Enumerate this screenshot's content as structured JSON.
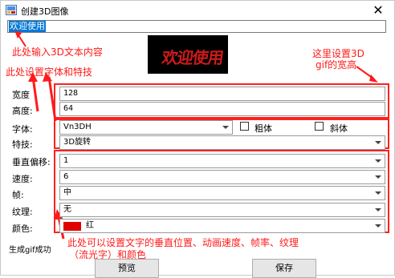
{
  "window": {
    "title": "创建3D图像",
    "close_glyph": "✕"
  },
  "text_input": {
    "value": "欢迎使用"
  },
  "preview": {
    "text": "欢迎使用"
  },
  "annotations": {
    "text_input_note": "此处输入3D文本内容",
    "font_note": "此处设置字体和特技",
    "size_note_line1": "这里设置3D",
    "size_note_line2": "gif的宽高",
    "anim_note_line1": "此处可以设置文字的垂直位置、动画速度、帧率、纹理",
    "anim_note_line2": "（流光字）和颜色"
  },
  "form": {
    "width_label": "宽度",
    "width_value": "128",
    "height_label": "高度:",
    "height_value": "64",
    "font_label": "字体:",
    "font_value": "Vn3DH",
    "bold_label": "粗体",
    "italic_label": "斜体",
    "effect_label": "特技:",
    "effect_value": "3D旋转",
    "voffset_label": "垂直偏移:",
    "voffset_value": "1",
    "speed_label": "速度:",
    "speed_value": "6",
    "frame_label": "帧:",
    "frame_value": "中",
    "texture_label": "纹理:",
    "texture_value": "无",
    "color_label": "颜色:",
    "color_value": "红",
    "color_hex": "#e00000"
  },
  "status": {
    "text": "生成gif成功"
  },
  "buttons": {
    "preview_label": "预览",
    "save_label": "保存"
  }
}
